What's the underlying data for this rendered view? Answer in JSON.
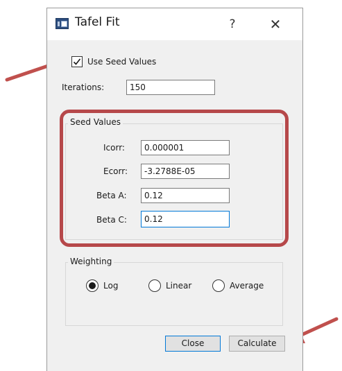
{
  "window": {
    "title": "Tafel Fit",
    "help_glyph": "?",
    "close_glyph": "✕",
    "app_icon": "window-app-icon"
  },
  "options": {
    "use_seed_values_label": "Use Seed Values",
    "use_seed_values_checked": true,
    "iterations_label": "Iterations:",
    "iterations_value": "150"
  },
  "seed_values": {
    "group_title": "Seed Values",
    "icorr_label": "Icorr:",
    "icorr_value": "0.000001",
    "ecorr_label": "Ecorr:",
    "ecorr_value": "-3.2788E-05",
    "beta_a_label": "Beta A:",
    "beta_a_value": "0.12",
    "beta_c_label": "Beta C:",
    "beta_c_value": "0.12"
  },
  "weighting": {
    "group_title": "Weighting",
    "options": [
      {
        "label": "Log",
        "selected": true
      },
      {
        "label": "Linear",
        "selected": false
      },
      {
        "label": "Average",
        "selected": false
      }
    ]
  },
  "buttons": {
    "close_label": "Close",
    "calculate_label": "Calculate"
  },
  "annotations": {
    "highlight_color": "#b6484a",
    "arrow_color": "#c0504d"
  }
}
